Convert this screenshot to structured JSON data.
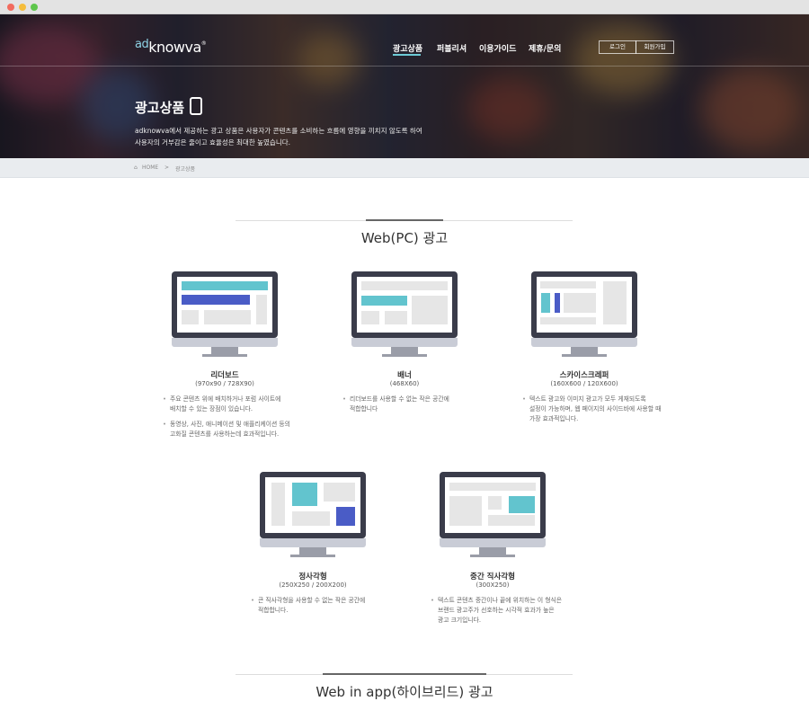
{
  "header": {
    "logo_ad": "ad",
    "logo_main": "knowva",
    "logo_reg": "®",
    "nav": [
      "광고상품",
      "퍼블리셔",
      "이용가이드",
      "제휴/문의"
    ],
    "login": "로그인",
    "signup": "회원가입"
  },
  "hero": {
    "title": "광고상품",
    "desc_line1": "adknowva에서 제공하는 광고 상품은 사용자가 콘텐츠를 소비하는 흐름에 영향을 끼치지 않도록 하여",
    "desc_line2": "사용자의 거부감은 줄이고 효율성은 최대한 높였습니다."
  },
  "breadcrumb": {
    "home": "HOME",
    "sep": ">",
    "current": "광고상품"
  },
  "sections": {
    "web_pc": "Web(PC) 광고",
    "web_app": "Web in app(하이브리드) 광고"
  },
  "cards": [
    {
      "title": "리더보드",
      "size": "(970x90 / 728X90)",
      "bullets": [
        [
          "주요 콘텐츠 위에 배치하거나 포럼 사이트에",
          "배치할 수 있는 장점이 있습니다."
        ],
        [
          "동영상, 사진, 애니메이션 및 애플리케이션 등의",
          "고화질 콘텐츠를 사용하는데 효과적입니다."
        ]
      ]
    },
    {
      "title": "배너",
      "size": "(468X60)",
      "bullets": [
        [
          "리더보드를 사용할 수 없는 작은 공간에",
          "적합합니다"
        ]
      ]
    },
    {
      "title": "스카이스크레퍼",
      "size": "(160X600 / 120X600)",
      "bullets": [
        [
          "텍스트 광고와 이미지 광고가 모두 게재되도록",
          "설정이 가능하며, 웹 페이지의 사이드바에 사용할 때",
          "가장 효과적입니다."
        ]
      ]
    },
    {
      "title": "정사각형",
      "size": "(250X250 / 200X200)",
      "bullets": [
        [
          "큰 직사각형을 사용할 수 없는 작은 공간에",
          "적합합니다."
        ]
      ]
    },
    {
      "title": "중간 직사각형",
      "size": "(300X250)",
      "bullets": [
        [
          "텍스트 콘텐츠 중간이나 끝에 위치하는 이 형식은",
          "브랜드 광고주가 선호하는 시각적 효과가 높은",
          "광고 크기입니다."
        ]
      ]
    }
  ]
}
